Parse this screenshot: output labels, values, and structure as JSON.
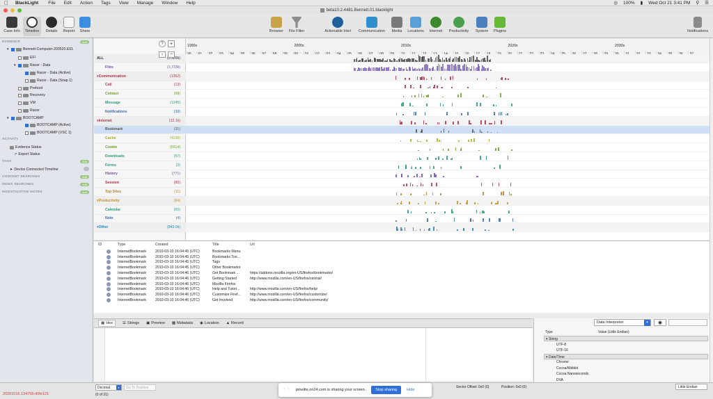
{
  "menubar": {
    "app": "BlackLight",
    "menus": [
      "File",
      "Edit",
      "Action",
      "Tags",
      "View",
      "Manage",
      "Window",
      "Help"
    ],
    "battery": "100%",
    "clock": "Wed Oct 21  3:41 PM"
  },
  "window": {
    "title": "beta10.2.4481.Bennett.01.blacklight"
  },
  "toolbar": {
    "left": [
      "Case Info",
      "Timeline",
      "Details",
      "Report",
      "Share"
    ],
    "center": [
      "Browser",
      "File Filter",
      "Actionable Intel",
      "Communication",
      "Media",
      "Locations",
      "Internet",
      "Productivity",
      "System",
      "Plugins"
    ],
    "right": "Notifications"
  },
  "sidebar": {
    "evidence_label": "EVIDENCE",
    "add_label": "Add",
    "tree": [
      {
        "label": "Bennett-Computer-200520.E01",
        "level": 0,
        "checked": true
      },
      {
        "label": "EFI",
        "level": 1,
        "checked": false
      },
      {
        "label": "Racer - Data",
        "level": 1,
        "checked": true
      },
      {
        "label": "Racer - Data (Active)",
        "level": 2,
        "checked": true
      },
      {
        "label": "Racer - Data (Snap 1)",
        "level": 2,
        "checked": false
      },
      {
        "label": "Preboot",
        "level": 1,
        "checked": false
      },
      {
        "label": "Recovery",
        "level": 1,
        "checked": false
      },
      {
        "label": "VM",
        "level": 1,
        "checked": false
      },
      {
        "label": "Racer",
        "level": 1,
        "checked": false
      },
      {
        "label": "BOOTCAMP",
        "level": 0,
        "checked": true
      },
      {
        "label": "BOOTCAMP (Active)",
        "level": 2,
        "checked": true
      },
      {
        "label": "BOOTCAMP (VSC 1)",
        "level": 2,
        "checked": false
      }
    ],
    "activity_label": "ACTIVITY",
    "activity": [
      "Evidence Status",
      "Export Status"
    ],
    "tags_label": "TAGS",
    "tags": [
      "Device Connected Timeline"
    ],
    "content_searches": "CONTENT SEARCHES",
    "index_searches": "INDEX SEARCHES",
    "investigative_notes": "INVESTIGATIVE NOTES"
  },
  "categories": [
    {
      "name": "ALL",
      "count": "(2,389k)",
      "group": true,
      "color": "#333"
    },
    {
      "name": "Files",
      "count": "(1,733k)",
      "group": false,
      "color": "#6c4fb0"
    },
    {
      "name": "Communication",
      "count": "(1352)",
      "group": true,
      "color": "#b0304a"
    },
    {
      "name": "Call",
      "count": "(13)",
      "group": false,
      "color": "#b0304a"
    },
    {
      "name": "Contact",
      "count": "(58)",
      "group": false,
      "color": "#6fa02a"
    },
    {
      "name": "Message",
      "count": "(1245)",
      "group": false,
      "color": "#2a9a80"
    },
    {
      "name": "Notifications",
      "count": "(38)",
      "group": false,
      "color": "#3b6ab0"
    },
    {
      "name": "Internet",
      "count": "(12.1k)",
      "group": true,
      "color": "#b0304a"
    },
    {
      "name": "Bookmark",
      "count": "(31)",
      "group": false,
      "color": "#555"
    },
    {
      "name": "Cache",
      "count": "(4238)",
      "group": false,
      "color": "#a4b020"
    },
    {
      "name": "Cookie",
      "count": "(6914)",
      "group": false,
      "color": "#6fa02a"
    },
    {
      "name": "Downloads",
      "count": "(57)",
      "group": false,
      "color": "#2a9a80"
    },
    {
      "name": "Forms",
      "count": "(3)",
      "group": false,
      "color": "#2a9a80"
    },
    {
      "name": "History",
      "count": "(771)",
      "group": false,
      "color": "#6c4fb0"
    },
    {
      "name": "Session",
      "count": "(80)",
      "group": false,
      "color": "#b0304a"
    },
    {
      "name": "Top Sites",
      "count": "(11)",
      "group": false,
      "color": "#c0802a"
    },
    {
      "name": "Productivity",
      "count": "(64)",
      "group": true,
      "color": "#c0902a"
    },
    {
      "name": "Calendar",
      "count": "(60)",
      "group": false,
      "color": "#2a9a80"
    },
    {
      "name": "Note",
      "count": "(4)",
      "group": false,
      "color": "#3b6ab0"
    },
    {
      "name": "Other",
      "count": "(843.0k)",
      "group": true,
      "color": "#2a80b0"
    }
  ],
  "timeline": {
    "decades": [
      "1990s",
      "2000s",
      "2010s",
      "2020s",
      "2030s"
    ],
    "years": [
      "90",
      "91",
      "92",
      "93",
      "94",
      "95",
      "96",
      "97",
      "98",
      "99",
      "00",
      "01",
      "02",
      "03",
      "04",
      "05",
      "06",
      "07",
      "08",
      "09",
      "10",
      "11",
      "12",
      "13",
      "14",
      "15",
      "16",
      "17",
      "18",
      "19",
      "20",
      "21",
      "22",
      "23",
      "24",
      "25",
      "26",
      "27",
      "28",
      "29",
      "30",
      "31",
      "32",
      "33",
      "34",
      "35",
      "36",
      "37"
    ]
  },
  "list": {
    "columns": [
      "ID",
      "Type",
      "Created",
      "Title",
      "Url"
    ],
    "rows": [
      {
        "type": "InternetBookmark",
        "created": "2010-03-10 16:04:45 (UTC)",
        "title": "Bookmarks Menu",
        "url": ""
      },
      {
        "type": "InternetBookmark",
        "created": "2010-03-10 16:04:45 (UTC)",
        "title": "Bookmarks Too...",
        "url": ""
      },
      {
        "type": "InternetBookmark",
        "created": "2010-03-10 16:04:45 (UTC)",
        "title": "Tags",
        "url": ""
      },
      {
        "type": "InternetBookmark",
        "created": "2010-03-10 16:04:45 (UTC)",
        "title": "Other Bookmarks",
        "url": ""
      },
      {
        "type": "InternetBookmark",
        "created": "2010-03-10 16:04:46 (UTC)",
        "title": "Get Bookmark ...",
        "url": "https://addons.mozilla.org/en-US/firefox/bookmarks/"
      },
      {
        "type": "InternetBookmark",
        "created": "2010-03-10 16:04:46 (UTC)",
        "title": "Getting Started",
        "url": "http://www.mozilla.com/en-US/firefox/central/"
      },
      {
        "type": "InternetBookmark",
        "created": "2010-03-10 16:04:46 (UTC)",
        "title": "Mozilla Firefox",
        "url": ""
      },
      {
        "type": "InternetBookmark",
        "created": "2010-03-10 16:04:46 (UTC)",
        "title": "Help and Tutori...",
        "url": "http://www.mozilla.com/en-US/firefox/help/"
      },
      {
        "type": "InternetBookmark",
        "created": "2010-03-10 16:04:46 (UTC)",
        "title": "Customize Firef...",
        "url": "http://www.mozilla.com/en-US/firefox/customize/"
      },
      {
        "type": "InternetBookmark",
        "created": "2010-03-10 16:04:46 (UTC)",
        "title": "Get Involved",
        "url": "http://www.mozilla.com/en-US/firefox/community/"
      }
    ]
  },
  "tabs": [
    "Hex",
    "Strings",
    "Preview",
    "Metadata",
    "Location",
    "Record"
  ],
  "interpreter": {
    "select": "Data Interpreter",
    "type_header": "Type",
    "value_header": "Value (Little Endian)",
    "rows": [
      {
        "label": "String",
        "group": true
      },
      {
        "label": "UTF-8",
        "group": false
      },
      {
        "label": "UTF-16",
        "group": false
      },
      {
        "label": "Date/Time",
        "group": true
      },
      {
        "label": "Chrome",
        "group": false
      },
      {
        "label": "Cocoa/Webkit",
        "group": false
      },
      {
        "label": "Cocoa Nanoseconds",
        "group": false
      },
      {
        "label": "DVA",
        "group": false
      }
    ]
  },
  "status": {
    "decimal": "Decimal",
    "go_to": "Go To Position",
    "selected": "20201016.134758-d0fe121",
    "count": "(0 of 31)",
    "sector_offset": "Sector Offset: 0x0 (0)",
    "position": "Position: 0x0 (0)",
    "endian": "Little Endian"
  },
  "share_banner": {
    "text": "pmelite.on24.com is sharing your screen.",
    "stop": "Stop sharing",
    "hide": "Hide"
  },
  "colors": {
    "selection": "#cfe0f6",
    "accent": "#2e6fd8",
    "add_badge": "#9ac77e"
  }
}
